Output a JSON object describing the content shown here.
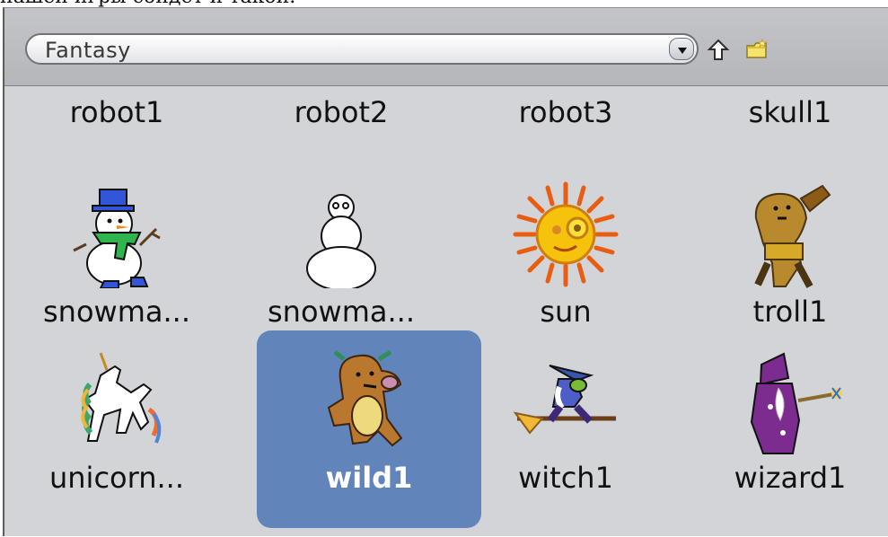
{
  "cut_off_text": "нашей игры сойдет и такой.",
  "toolbar": {
    "category": "Fantasy",
    "dropdown_arrow": "▼",
    "up_icon": "up-arrow-icon",
    "new_folder_icon": "new-folder-icon"
  },
  "rows": [
    {
      "items": [
        {
          "label": "robot1"
        },
        {
          "label": "robot2"
        },
        {
          "label": "robot3"
        },
        {
          "label": "skull1"
        }
      ]
    },
    {
      "items": [
        {
          "label": "snowma...",
          "icon": "snowman-scarf-icon"
        },
        {
          "label": "snowma...",
          "icon": "snowman-outline-icon"
        },
        {
          "label": "sun",
          "icon": "sun-icon"
        },
        {
          "label": "troll1",
          "icon": "troll-icon"
        }
      ]
    },
    {
      "items": [
        {
          "label": "unicorn...",
          "icon": "unicorn-icon"
        },
        {
          "label": "wild1",
          "icon": "wild-monster-icon",
          "selected": true
        },
        {
          "label": "witch1",
          "icon": "witch-on-broom-icon"
        },
        {
          "label": "wizard1",
          "icon": "wizard-icon"
        }
      ]
    }
  ]
}
